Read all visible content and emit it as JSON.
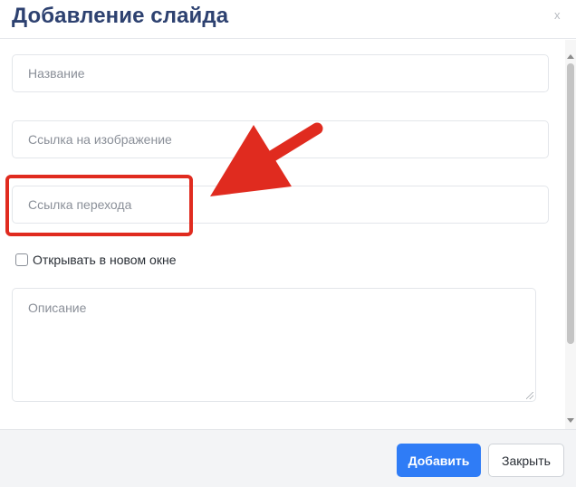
{
  "modal": {
    "title": "Добавление слайда",
    "close_x": "x"
  },
  "form": {
    "name_placeholder": "Название",
    "image_link_placeholder": "Ссылка на изображение",
    "target_link_placeholder": "Ссылка перехода",
    "open_new_window_label": "Открывать в новом окне",
    "open_new_window_checked": false,
    "description_placeholder": "Описание"
  },
  "footer": {
    "add_label": "Добавить",
    "close_label": "Закрыть"
  },
  "annotation": {
    "color": "#e02b1f"
  },
  "colors": {
    "title": "#2d4170",
    "primary_button": "#2f7cf6"
  }
}
